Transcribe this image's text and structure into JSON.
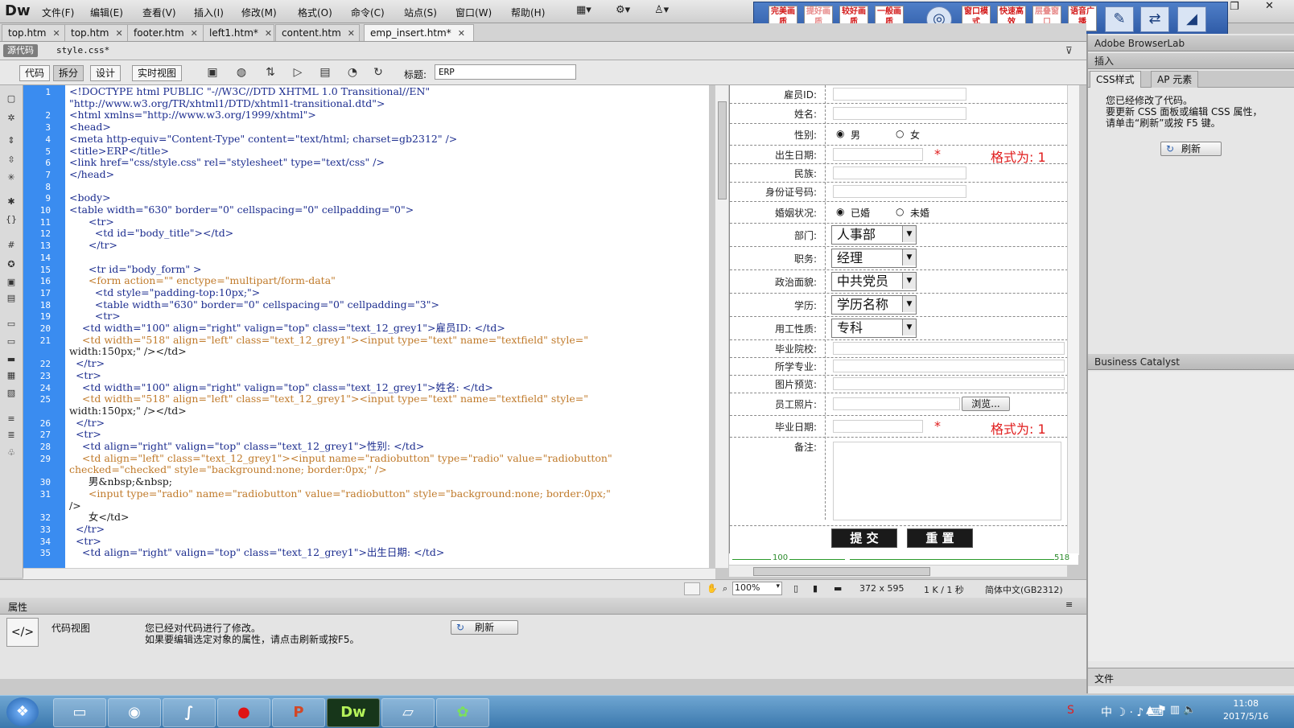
{
  "app": {
    "logo": "Dw"
  },
  "menus": [
    "文件(F)",
    "编辑(E)",
    "查看(V)",
    "插入(I)",
    "修改(M)",
    "格式(O)",
    "命令(C)",
    "站点(S)",
    "窗口(W)",
    "帮助(H)"
  ],
  "menu_icons": [
    "layout-icon",
    "gear-icon",
    "user-icon"
  ],
  "quick_toolbar": {
    "buttons": [
      "完美画质",
      "提好画质",
      "较好画质",
      "一般画质",
      "窗口模式",
      "快速高效",
      "层叠窗口",
      "语音广播"
    ],
    "icons": [
      "settings-icon",
      "pen-icon",
      "transfer-icon",
      "signal-icon"
    ]
  },
  "tabs": [
    {
      "label": "top.htm",
      "active": false
    },
    {
      "label": "top.htm",
      "active": false
    },
    {
      "label": "footer.htm",
      "active": false
    },
    {
      "label": "left1.htm*",
      "active": false
    },
    {
      "label": "content.htm",
      "active": false
    },
    {
      "label": "emp_insert.htm*",
      "active": true
    }
  ],
  "source_bar": {
    "button": "源代码",
    "file": "style.css*"
  },
  "doc_toolbar": {
    "views": [
      "代码",
      "拆分",
      "设计",
      "实时视图"
    ],
    "title_label": "标题:",
    "title_value": "ERP"
  },
  "code": {
    "line_numbers": [
      "1",
      "",
      "2",
      "3",
      "4",
      "5",
      "6",
      "7",
      "8",
      "9",
      "10",
      "11",
      "12",
      "13",
      "14",
      "15",
      "16",
      "17",
      "18",
      "19",
      "20",
      "21",
      "",
      "22",
      "23",
      "24",
      "25",
      "",
      "26",
      "27",
      "28",
      "29",
      "",
      "30",
      "31",
      "",
      "32",
      "33",
      "34",
      "35"
    ],
    "lines": [
      "<!DOCTYPE html PUBLIC \"-//W3C//DTD XHTML 1.0 Transitional//EN\"",
      "\"http://www.w3.org/TR/xhtml1/DTD/xhtml1-transitional.dtd\">",
      "<html xmlns=\"http://www.w3.org/1999/xhtml\">",
      "<head>",
      "<meta http-equiv=\"Content-Type\" content=\"text/html; charset=gb2312\" />",
      "<title>ERP</title>",
      "<link href=\"css/style.css\" rel=\"stylesheet\" type=\"text/css\" />",
      "</head>",
      "",
      "<body>",
      "<table width=\"630\" border=\"0\" cellspacing=\"0\" cellpadding=\"0\">",
      "      <tr>",
      "        <td id=\"body_title\"></td>",
      "      </tr>",
      "",
      "      <tr id=\"body_form\" >",
      "      <form action=\"\" enctype=\"multipart/form-data\"",
      "        <td style=\"padding-top:10px;\">",
      "        <table width=\"630\" border=\"0\" cellspacing=\"0\" cellpadding=\"3\">",
      "        <tr>",
      "    <td width=\"100\" align=\"right\" valign=\"top\" class=\"text_12_grey1\">雇员ID: </td>",
      "    <td width=\"518\" align=\"left\" class=\"text_12_grey1\"><input type=\"text\" name=\"textfield\" style=\"",
      "width:150px;\" /></td>",
      "  </tr>",
      "  <tr>",
      "    <td width=\"100\" align=\"right\" valign=\"top\" class=\"text_12_grey1\">姓名: </td>",
      "    <td width=\"518\" align=\"left\" class=\"text_12_grey1\"><input type=\"text\" name=\"textfield\" style=\"",
      "width:150px;\" /></td>",
      "  </tr>",
      "  <tr>",
      "    <td align=\"right\" valign=\"top\" class=\"text_12_grey1\">性别: </td>",
      "    <td align=\"left\" class=\"text_12_grey1\"><input name=\"radiobutton\" type=\"radio\" value=\"radiobutton\"",
      "checked=\"checked\" style=\"background:none; border:0px;\" />",
      "      男&nbsp;&nbsp;",
      "      <input type=\"radio\" name=\"radiobutton\" value=\"radiobutton\" style=\"background:none; border:0px;\"",
      "/>",
      "      女</td>",
      "  </tr>",
      "  <tr>",
      "    <td align=\"right\" valign=\"top\" class=\"text_12_grey1\">出生日期: </td>"
    ]
  },
  "design": {
    "rows": [
      {
        "label": "雇员ID:",
        "type": "text"
      },
      {
        "label": "姓名:",
        "type": "text"
      },
      {
        "label": "性别:",
        "type": "radio",
        "options": [
          "男",
          "女"
        ]
      },
      {
        "label": "出生日期:",
        "type": "date",
        "star": "*",
        "hint": "格式为: 1"
      },
      {
        "label": "民族:",
        "type": "text"
      },
      {
        "label": "身份证号码:",
        "type": "text"
      },
      {
        "label": "婚姻状况:",
        "type": "radio",
        "options": [
          "已婚",
          "未婚"
        ]
      },
      {
        "label": "部门:",
        "type": "select",
        "value": "人事部"
      },
      {
        "label": "职务:",
        "type": "select",
        "value": "经理"
      },
      {
        "label": "政治面貌:",
        "type": "select",
        "value": "中共党员"
      },
      {
        "label": "学历:",
        "type": "select",
        "value": "学历名称"
      },
      {
        "label": "用工性质:",
        "type": "select",
        "value": "专科"
      },
      {
        "label": "毕业院校:",
        "type": "line"
      },
      {
        "label": "所学专业:",
        "type": "line"
      },
      {
        "label": "图片预览:",
        "type": "line"
      },
      {
        "label": "员工照片:",
        "type": "file",
        "button": "浏览..."
      },
      {
        "label": "毕业日期:",
        "type": "date",
        "star": "*",
        "hint": "格式为: 1"
      },
      {
        "label": "备注:",
        "type": "textarea"
      }
    ],
    "submit": "提 交",
    "reset": "重 置",
    "ruler_left": "100",
    "ruler_right": "518"
  },
  "status_bar": {
    "zoom": "100%",
    "size": "372 x 595",
    "file_info": "1 K / 1 秒",
    "encoding": "简体中文(GB2312)"
  },
  "properties": {
    "header": "属性",
    "view_label": "代码视图",
    "message_line1": "您已经对代码进行了修改。",
    "message_line2": "如果要编辑选定对象的属性，请点击刷新或按F5。",
    "refresh": "刷新"
  },
  "right_panel": {
    "browserlab": "Adobe BrowserLab",
    "insert": "插入",
    "css_tab": "CSS样式",
    "ap_tab": "AP 元素",
    "css_message": "您已经修改了代码。\n要更新 CSS 面板或编辑 CSS 属性，请单击“刷新”或按 F5 键。",
    "refresh": "刷新",
    "business_catalyst": "Business Catalyst",
    "files_label": "文件"
  },
  "taskbar": {
    "apps": [
      "start-icon",
      "explorer-icon",
      "chrome-icon",
      "pen-app-icon",
      "record-icon",
      "powerpoint-icon",
      "dreamweaver-icon",
      "folder-icon",
      "green-app-icon"
    ],
    "time": "11:08",
    "date": "2017/5/16",
    "ime": "中"
  }
}
